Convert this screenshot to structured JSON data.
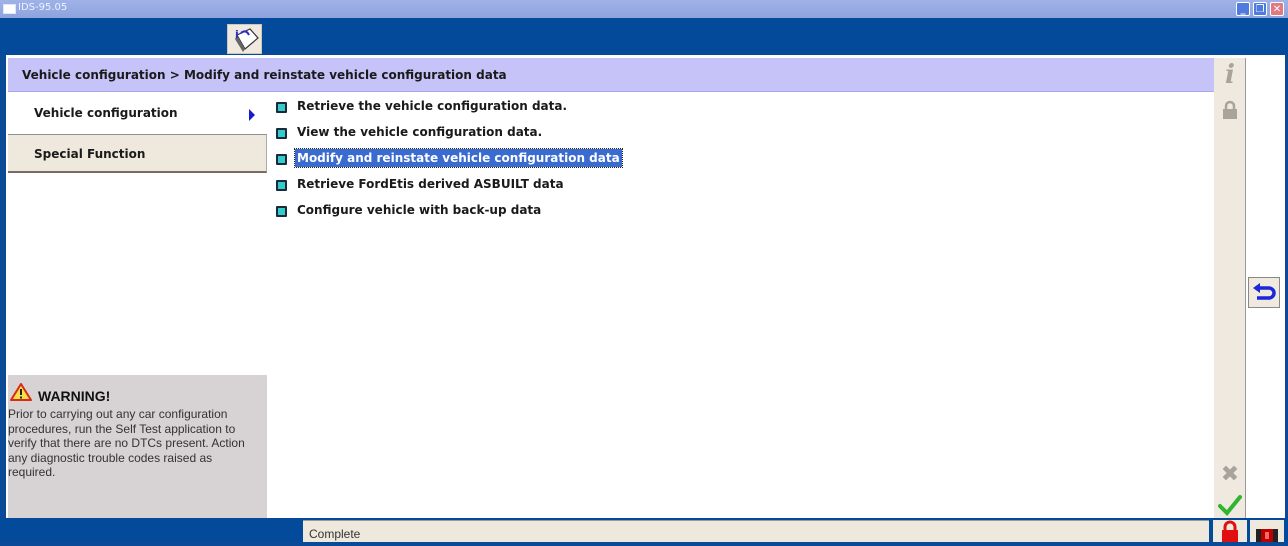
{
  "window": {
    "title": "IDS-95.05",
    "controls": [
      "minimize",
      "restore",
      "close"
    ]
  },
  "toolbar": {
    "info_button_icon": "info-book-icon"
  },
  "breadcrumb": {
    "text": "Vehicle configuration > Modify and reinstate vehicle configuration data"
  },
  "leftnav": {
    "tabs": [
      {
        "label": "Vehicle configuration",
        "active": true
      },
      {
        "label": "Special Function",
        "active": false
      }
    ]
  },
  "menu": {
    "items": [
      {
        "label": "Retrieve the vehicle configuration data.",
        "selected": false
      },
      {
        "label": "View the vehicle configuration data.",
        "selected": false
      },
      {
        "label": "Modify and reinstate vehicle configuration data",
        "selected": true
      },
      {
        "label": "Retrieve FordEtis derived ASBUILT data",
        "selected": false
      },
      {
        "label": "Configure vehicle with back-up data",
        "selected": false
      }
    ]
  },
  "warning": {
    "title": "WARNING!",
    "text": "Prior to carrying out any car configuration procedures, run the Self Test application to verify that there are no DTCs present. Action any diagnostic trouble codes raised as required."
  },
  "rightbar": {
    "icons": [
      "info-icon",
      "lock-icon",
      "cancel-icon",
      "confirm-check-icon"
    ]
  },
  "back_button": {
    "icon": "back-arrow-icon"
  },
  "status": {
    "text": "Complete"
  },
  "colors": {
    "app_blue": "#034a9a",
    "breadcrumb_bg": "#c6c3f9",
    "selection": "#3a6bd1",
    "panel_beige": "#efe9df",
    "warning_bg": "#d7d2d3"
  }
}
